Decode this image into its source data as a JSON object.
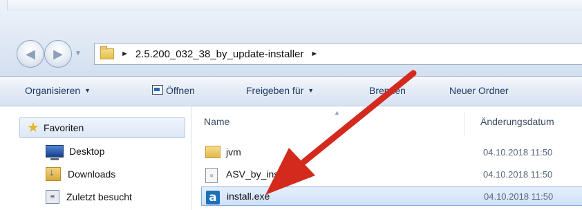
{
  "address": {
    "path_label": "2.5.200_032_38_by_update-installer"
  },
  "toolbar": {
    "organize_label": "Organisieren",
    "open_label": "Öffnen",
    "share_label": "Freigeben für",
    "burn_label": "Brennen",
    "new_folder_label": "Neuer Ordner"
  },
  "navpane": {
    "favorites_label": "Favoriten",
    "items": [
      {
        "label": "Desktop",
        "icon": "desktop-icon"
      },
      {
        "label": "Downloads",
        "icon": "downloads-folder-icon"
      },
      {
        "label": "Zuletzt besucht",
        "icon": "recent-places-icon"
      }
    ]
  },
  "filelist": {
    "col_name": "Name",
    "col_date": "Änderungsdatum",
    "rows": [
      {
        "name": "jvm",
        "date": "04.10.2018 11:50",
        "icon": "folder-icon",
        "selected": false
      },
      {
        "name": "ASV_by_installer.jar",
        "date": "04.10.2018 11:50",
        "icon": "jar-file-icon",
        "selected": false
      },
      {
        "name": "install.exe",
        "date": "04.10.2018 11:50",
        "icon": "exe-file-icon",
        "selected": true
      }
    ]
  },
  "annotation": {
    "arrow_color": "#d42a1e"
  }
}
